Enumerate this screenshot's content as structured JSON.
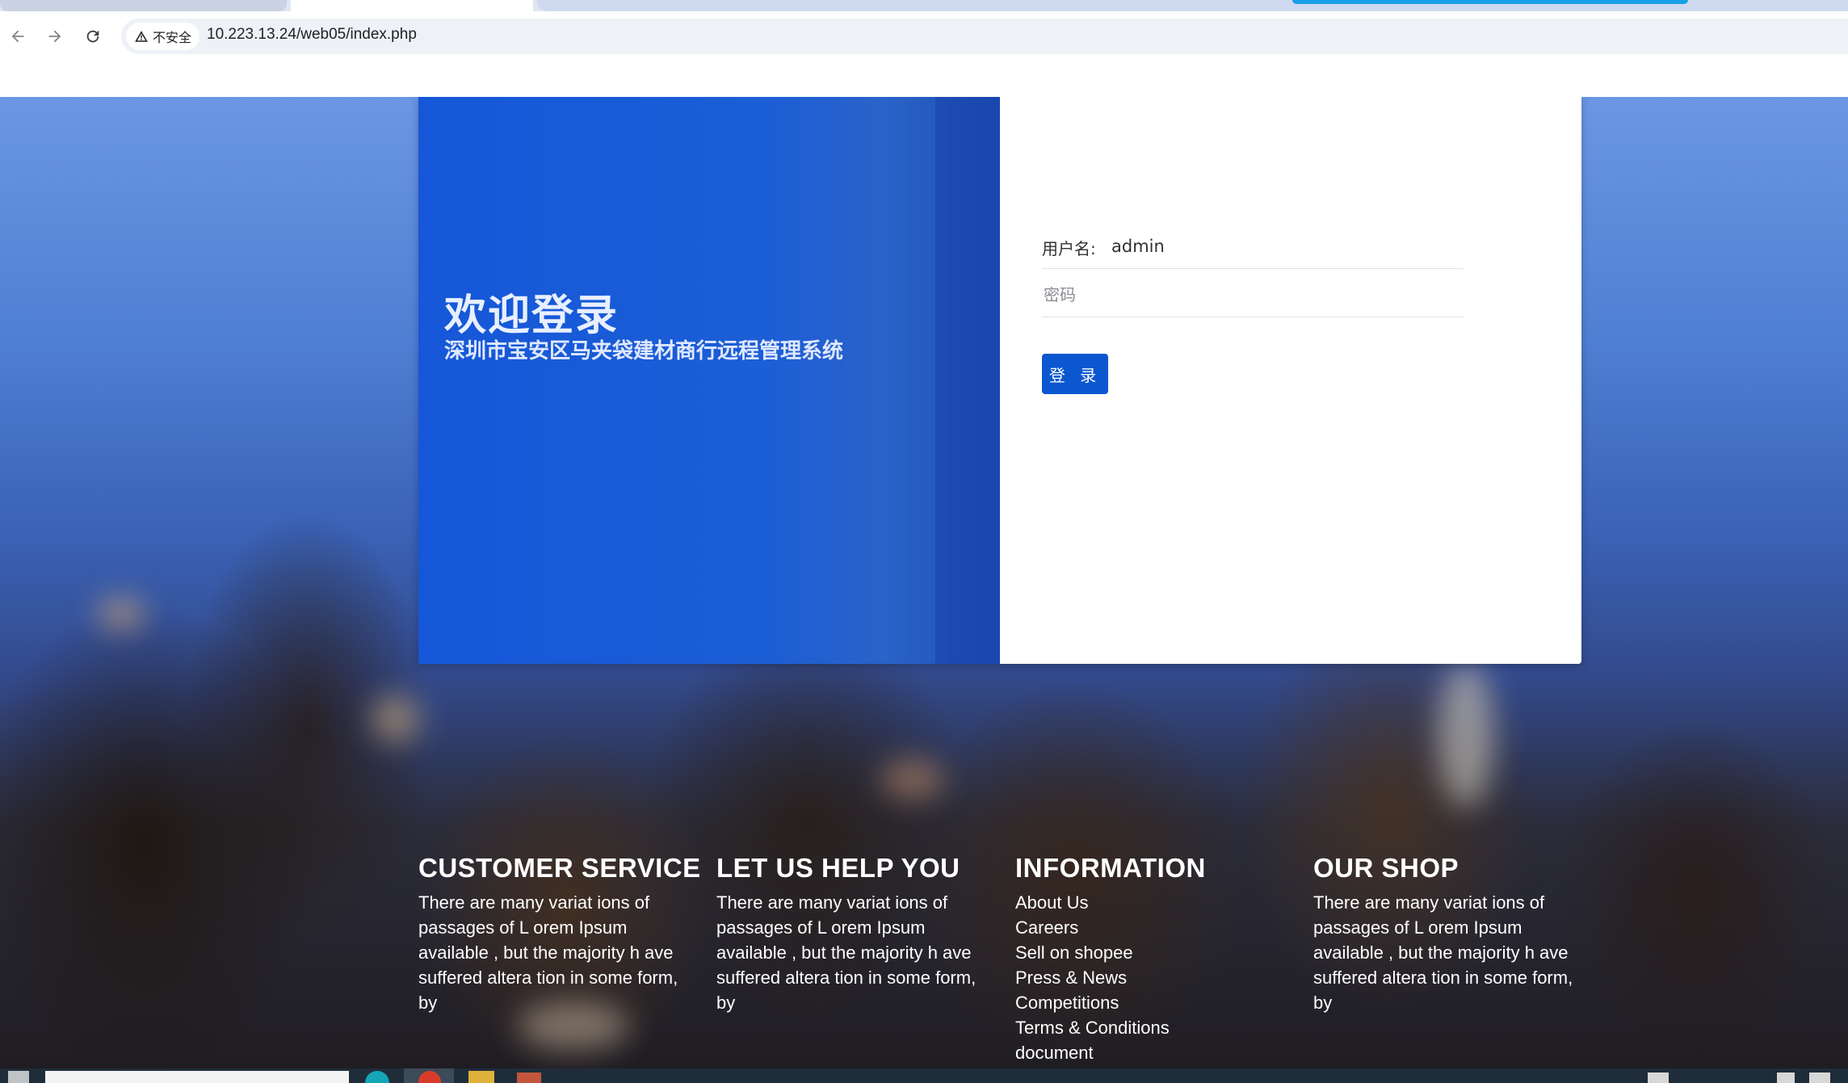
{
  "browser": {
    "security_label": "不安全",
    "url": "10.223.13.24/web05/index.php"
  },
  "welcome": {
    "title": "欢迎登录",
    "subtitle": "深圳市宝安区马夹袋建材商行远程管理系统"
  },
  "login_form": {
    "username_label": "用户名:",
    "username_value": "admin",
    "password_placeholder": "密码",
    "submit_label": "登 录",
    "button_color": "#0b57d0"
  },
  "footer": {
    "customer_service": {
      "heading": "CUSTOMER SERVICE",
      "text": "There are many variat ions of passages of L orem Ipsum available , but the majority h ave suffered altera tion in some form, by"
    },
    "help": {
      "heading": "LET US HELP YOU",
      "text": "There are many variat ions of passages of L orem Ipsum available , but the majority h ave suffered altera tion in some form, by"
    },
    "information": {
      "heading": "INFORMATION",
      "links": [
        "About Us",
        "Careers",
        "Sell on shopee",
        "Press & News",
        "Competitions",
        "Terms & Conditions",
        "document"
      ]
    },
    "shop": {
      "heading": "OUR SHOP",
      "text": "There are many variat ions of passages of L orem Ipsum available , but the majority h ave suffered altera tion in some form, by"
    }
  },
  "icons": [
    "back-arrow-icon",
    "forward-arrow-icon",
    "reload-icon",
    "warning-triangle-icon"
  ]
}
